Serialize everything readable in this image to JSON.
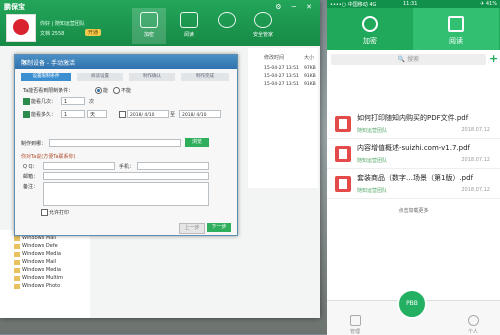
{
  "app": {
    "name": "鹏保宝",
    "user": "你好 | 随知运营团队",
    "status": "文档 2558",
    "badge": "开通",
    "nav": [
      "加密",
      "阅读",
      "",
      "安全管家"
    ],
    "win_controls": "⚙ ─ ✕",
    "list": {
      "header_time": "修改时间",
      "header_size": "大小",
      "rows": [
        {
          "time": "15-04-27 13:51",
          "size": "97KB"
        },
        {
          "time": "15-04-27 13:51",
          "size": "91KB"
        },
        {
          "time": "15-04-27 13:51",
          "size": "91KB"
        }
      ]
    },
    "tree": [
      "Windows Mail",
      "Windows Defe",
      "Windows Media",
      "Windows Mail",
      "Windows Media",
      "Windows Multim",
      "Windows Photo"
    ]
  },
  "dialog": {
    "title": "限制设备 - 手动激活",
    "close": "✕",
    "steps": [
      "设置限制条件",
      "阅读设置",
      "制作确认",
      "制作完成"
    ],
    "condition_label": "Ta能否看到限制条件：",
    "condition_yes": "能",
    "condition_no": "不能",
    "times_label": "能看几次：",
    "times_value": "1",
    "times_unit": "次",
    "days_label": "能看多久：",
    "days_value": "1",
    "days_unit": "天",
    "date_from": "2018/ 4/10",
    "date_sep": "至",
    "date_to": "2018/ 4/10",
    "save_path_label": "制作到哪：",
    "browse": "浏览",
    "contact_label": "你对Ta说(方便Ta联系你)",
    "qq_label": "Q  Q：",
    "phone_label": "手机：",
    "email_label": "邮箱：",
    "note_label": "备注：",
    "allow_print": "允许打印",
    "prev": "上一步",
    "next": "下一步"
  },
  "phone": {
    "status_left": "••••○ 中国移动 4G",
    "status_time": "11:31",
    "status_right": "✈ 41%",
    "tabs": [
      "加密",
      "阅读"
    ],
    "search_placeholder": "🔍 搜索",
    "add": "+",
    "items": [
      {
        "title": "如何打印随知内购买的PDF文件.pdf",
        "source": "随知运营团队",
        "date": "2018.07.12"
      },
      {
        "title": "内容增值概述-suizhi.com-v1.7.pdf",
        "source": "随知运营团队",
        "date": "2018.07.12"
      },
      {
        "title": "套装商品（数字…场景（第1版）.pdf",
        "source": "随知运营团队",
        "date": "2018.07.12"
      }
    ],
    "load_more": "点击加载更多",
    "footer": {
      "left": "管理",
      "center": "PBB",
      "right": "个人"
    }
  }
}
